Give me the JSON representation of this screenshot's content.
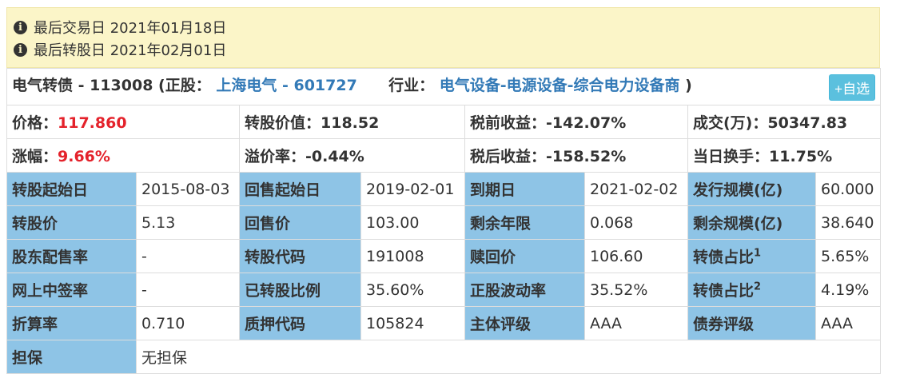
{
  "notice": {
    "last_trade": "最后交易日 2021年01月18日",
    "last_convert": "最后转股日 2021年02月01日"
  },
  "header": {
    "bond_name": "电气转债 - 113008 (正股：",
    "stock_link": "上海电气 - 601727",
    "industry_label": "行业：",
    "industry_link": "电气设备-电源设备-综合电力设备商",
    "industry_close": ")",
    "add_button": "+自选"
  },
  "summary": {
    "price_label": "价格：",
    "price_value": "117.860",
    "conv_value_label": "转股价值：",
    "conv_value": "118.52",
    "pretax_label": "税前收益：",
    "pretax_value": "-142.07%",
    "volume_label": "成交(万)：",
    "volume_value": "50347.83",
    "change_label": "涨幅：",
    "change_value": "9.66%",
    "premium_label": "溢价率：",
    "premium_value": "-0.44%",
    "aftertax_label": "税后收益：",
    "aftertax_value": "-158.52%",
    "turnover_label": "当日换手：",
    "turnover_value": "11.75%"
  },
  "details": {
    "r1": [
      "转股起始日",
      "2015-08-03",
      "回售起始日",
      "2019-02-01",
      "到期日",
      "2021-02-02",
      "发行规模(亿)",
      "60.000"
    ],
    "r2": [
      "转股价",
      "5.13",
      "回售价",
      "103.00",
      "剩余年限",
      "0.068",
      "剩余规模(亿)",
      "38.640"
    ],
    "r3": [
      "股东配售率",
      "-",
      "转股代码",
      "191008",
      "赎回价",
      "106.60",
      "转债占比",
      "5.65%"
    ],
    "r3_sup": "1",
    "r4": [
      "网上中签率",
      "-",
      "已转股比例",
      "35.60%",
      "正股波动率",
      "35.52%",
      "转债占比",
      "4.19%"
    ],
    "r4_sup": "2",
    "r5": [
      "折算率",
      "0.710",
      "质押代码",
      "105824",
      "主体评级",
      "AAA",
      "债券评级",
      "AAA"
    ],
    "r6": [
      "担保",
      "无担保"
    ]
  },
  "colors": {
    "notice_bg": "#fbf5c8",
    "header_cell": "#8ec4e6",
    "link": "#337ab7",
    "up_red": "#e4222b",
    "button": "#5bc0de"
  }
}
